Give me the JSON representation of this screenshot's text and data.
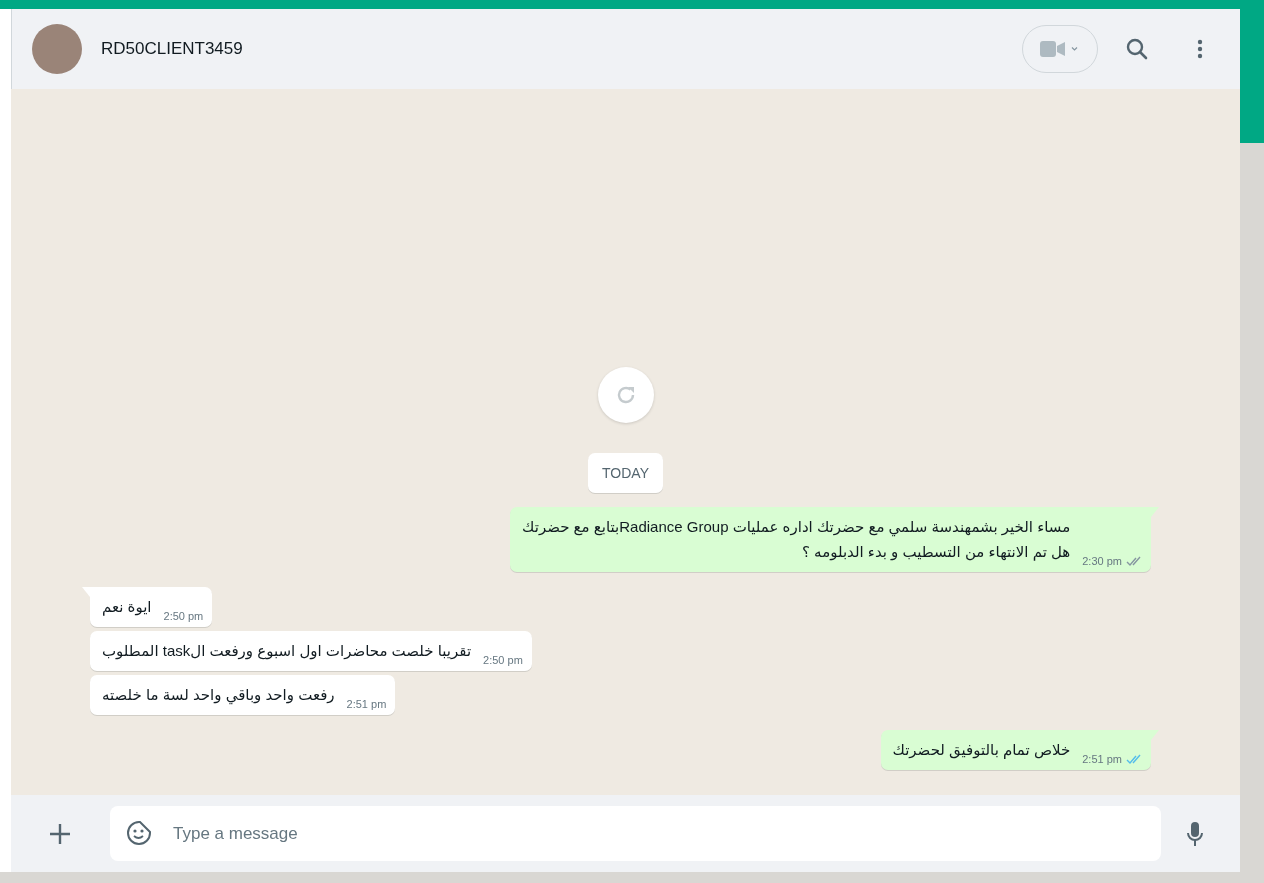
{
  "header": {
    "contact_name": "RD50CLIENT3459"
  },
  "chat": {
    "date_label": "TODAY",
    "messages": [
      {
        "kind": "outgoing",
        "tail": true,
        "text": "مساء الخير بشمهندسة سلمي مع  حضرتك اداره عمليات Radiance Groupبتابع مع حضرتك\nهل تم الانتهاء من التسطيب و بدء الدبلومه ؟",
        "time": "2:30 pm",
        "read": false
      },
      {
        "kind": "incoming",
        "tail": true,
        "text": "ايوة نعم",
        "time": "2:50 pm"
      },
      {
        "kind": "incoming",
        "tail": false,
        "text": "تقريبا خلصت محاضرات اول اسبوع ورفعت الtask المطلوب",
        "time": "2:50 pm"
      },
      {
        "kind": "incoming",
        "tail": false,
        "text": "رفعت واحد وباقي واحد لسة ما خلصته",
        "time": "2:51 pm"
      },
      {
        "kind": "outgoing",
        "tail": true,
        "text": "خلاص تمام بالتوفيق لحضرتك",
        "time": "2:51 pm",
        "read": true
      }
    ]
  },
  "composer": {
    "placeholder": "Type a message"
  }
}
